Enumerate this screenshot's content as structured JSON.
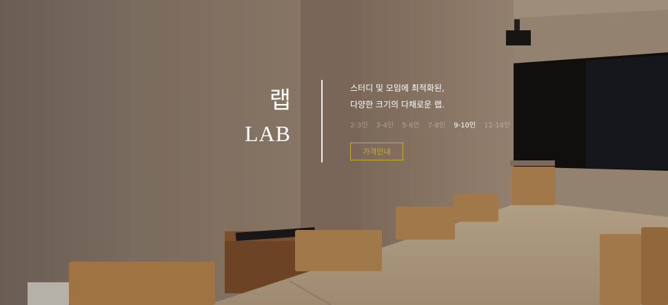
{
  "hero": {
    "title_ko": "랩",
    "title_en": "LAB",
    "tagline_line1": "스터디 및 모임에 최적화된,",
    "tagline_line2": "다양한 크기의 다채로운 랩.",
    "price_button": "가격안내",
    "accent_color": "#c9ad3a"
  },
  "room_sizes": [
    {
      "label": "2-3인",
      "active": false
    },
    {
      "label": "3-4인",
      "active": false
    },
    {
      "label": "5-6인",
      "active": false
    },
    {
      "label": "7-8인",
      "active": false
    },
    {
      "label": "9-10인",
      "active": true
    },
    {
      "label": "12-18인",
      "active": false
    }
  ]
}
